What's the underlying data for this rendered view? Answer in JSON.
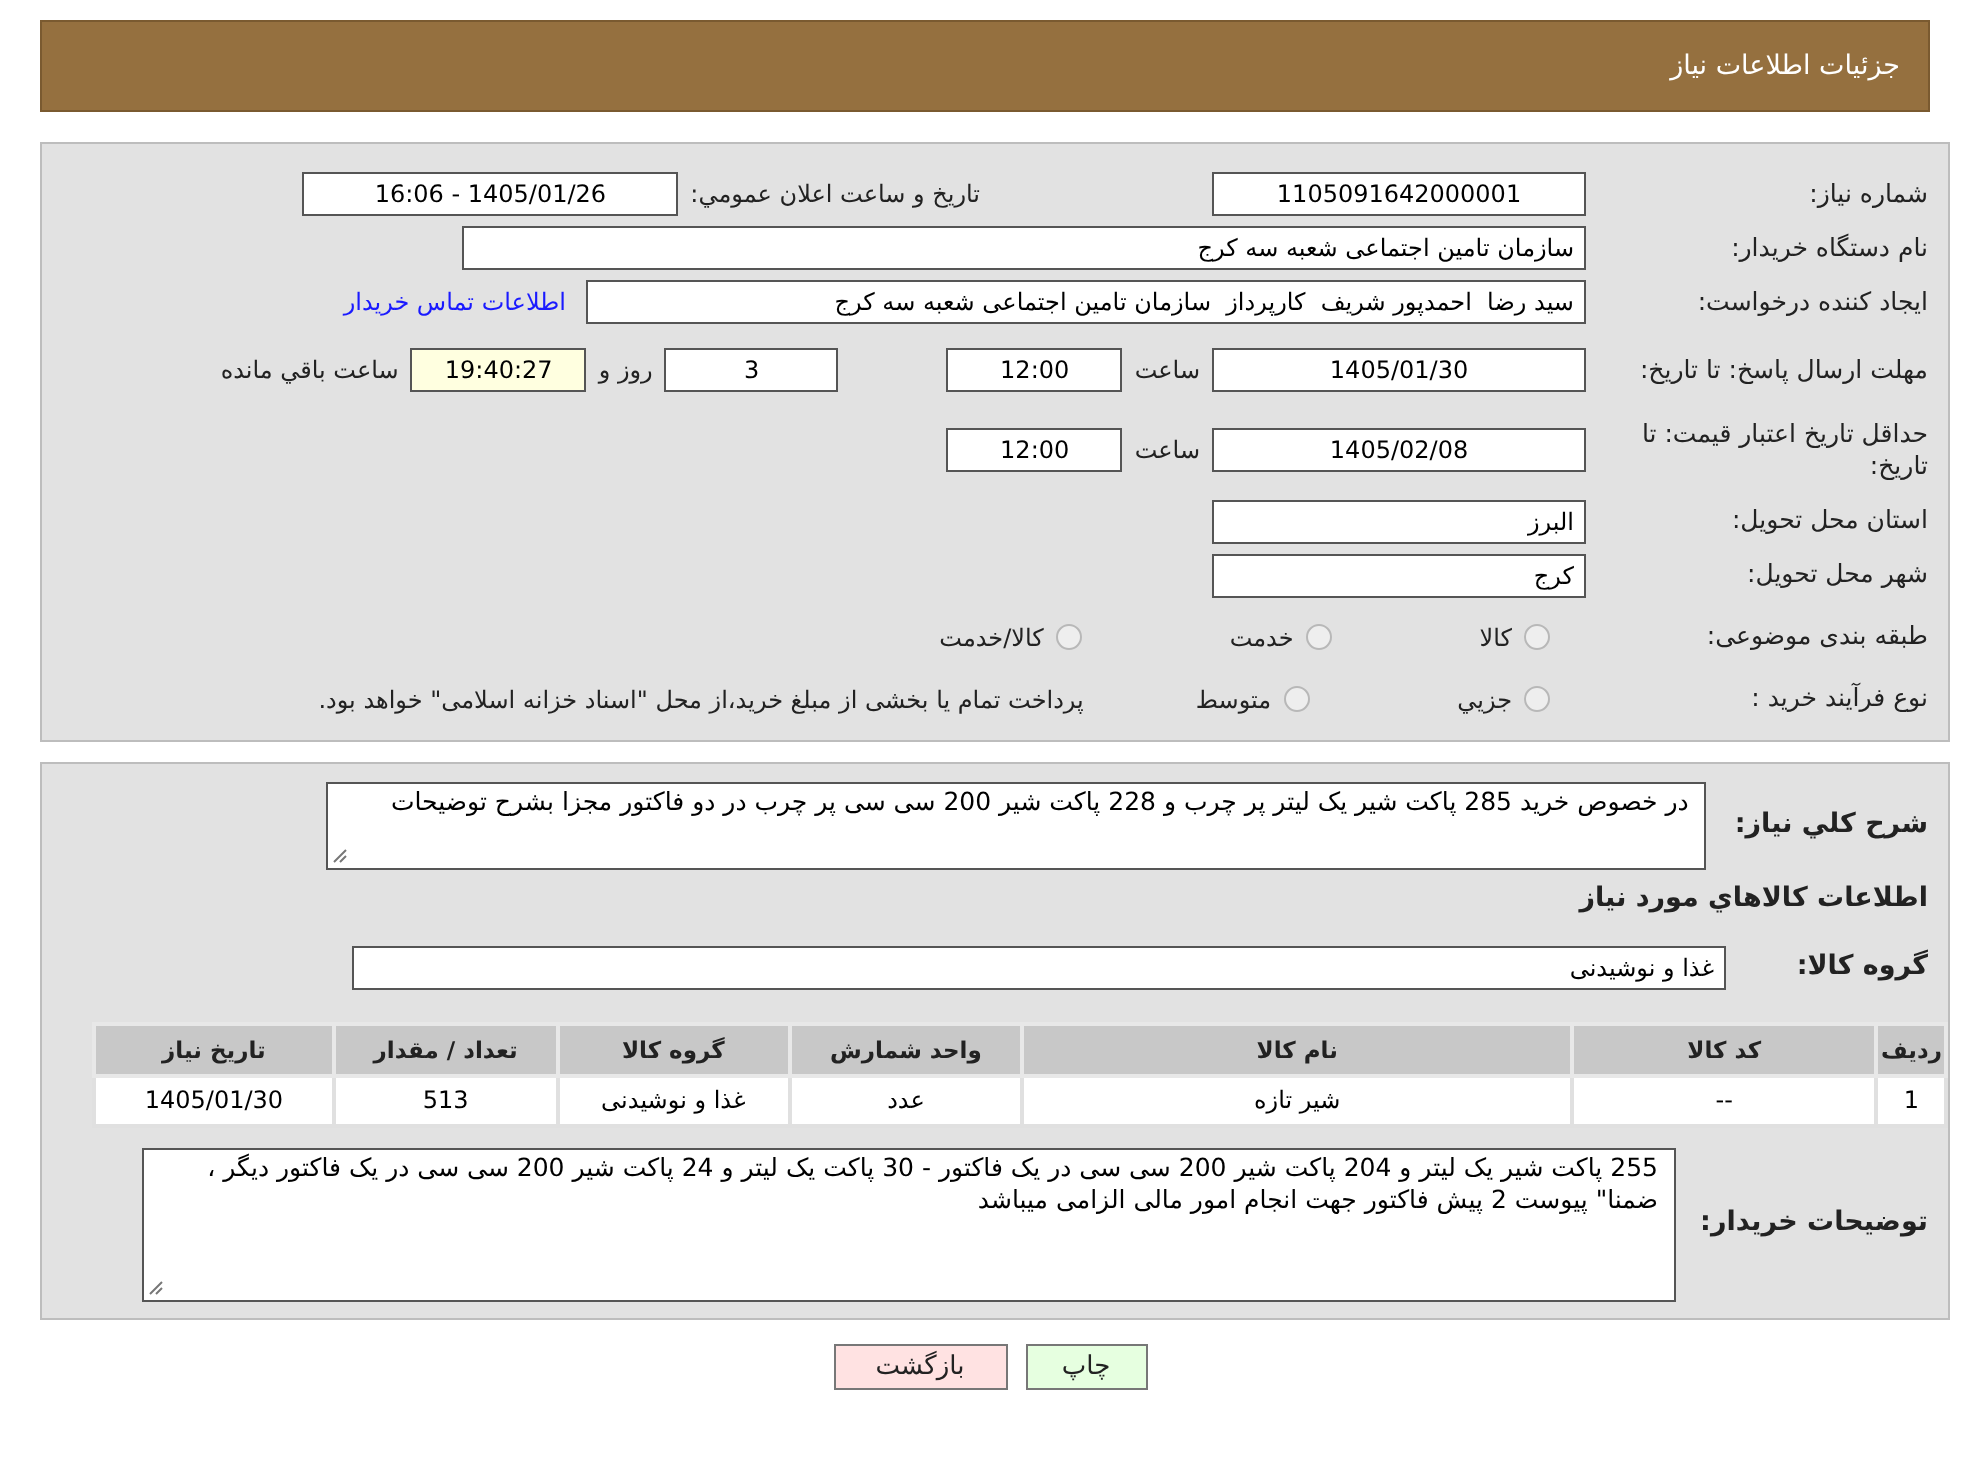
{
  "header": {
    "title": "جزئیات اطلاعات نیاز"
  },
  "need_number": {
    "label": "شماره نیاز:",
    "value": "1105091642000001"
  },
  "announce": {
    "label": "تاریخ و ساعت اعلان عمومي:",
    "value": "1405/01/26 - 16:06"
  },
  "buyer_org": {
    "label": "نام دستگاه خریدار:",
    "value": "سازمان تامین اجتماعی شعبه سه کرج"
  },
  "requester": {
    "label": "ایجاد کننده درخواست:",
    "value": "سید رضا  احمدپور شریف  کارپرداز  سازمان تامین اجتماعی شعبه سه کرج",
    "link": "اطلاعات تماس خریدار"
  },
  "reply_deadline": {
    "label": "مهلت ارسال پاسخ: تا تاریخ:",
    "date": "1405/01/30",
    "time_label": "ساعت",
    "time": "12:00",
    "days": "3",
    "days_label": "روز و",
    "remaining": "19:40:27",
    "remaining_label": "ساعت باقي مانده"
  },
  "price_validity": {
    "label": "حداقل تاریخ اعتبار قیمت: تا تاریخ:",
    "date": "1405/02/08",
    "time_label": "ساعت",
    "time": "12:00"
  },
  "province": {
    "label": "استان محل تحویل:",
    "value": "البرز"
  },
  "city": {
    "label": "شهر محل تحویل:",
    "value": "کرج"
  },
  "category": {
    "label": "طبقه بندی موضوعی:",
    "options": [
      {
        "label": "کالا",
        "selected": false
      },
      {
        "label": "خدمت",
        "selected": false
      },
      {
        "label": "کالا/خدمت",
        "selected": false
      }
    ]
  },
  "purchase_type": {
    "label": "نوع فرآیند خرید :",
    "options": [
      {
        "label": "جزيي",
        "selected": false
      },
      {
        "label": "متوسط",
        "selected": false
      }
    ],
    "note": "پرداخت تمام یا بخشی از مبلغ خرید،از محل \"اسناد خزانه اسلامی\" خواهد بود."
  },
  "summary": {
    "label": "شرح کلي نیاز:",
    "value": "در خصوص خرید 285 پاکت شیر یک لیتر پر چرب و 228 پاکت شیر 200 سی سی پر چرب در دو فاکتور مجزا بشرح توضیحات"
  },
  "goods_heading": "اطلاعات کالاهاي مورد نیاز",
  "goods_group": {
    "label": "گروه کالا:",
    "value": "غذا و نوشیدنی"
  },
  "table": {
    "columns": [
      "ردیف",
      "کد کالا",
      "نام کالا",
      "واحد شمارش",
      "گروه کالا",
      "تعداد / مقدار",
      "تاریخ نیاز"
    ],
    "rows": [
      [
        "1",
        "--",
        "شیر تازه",
        "عدد",
        "غذا و نوشیدنی",
        "513",
        "1405/01/30"
      ]
    ]
  },
  "buyer_notes": {
    "label": "توضیحات خریدار:",
    "value": "255 پاکت شیر یک لیتر و 204 پاکت شیر 200 سی سی در یک فاکتور - 30 پاکت یک لیتر و 24 پاکت شیر 200 سی سی در یک فاکتور دیگر ، ضمنا\" پیوست 2 پیش فاکتور جهت انجام امور مالی الزامی میباشد"
  },
  "buttons": [
    {
      "label": "چاپ",
      "kind": "print"
    },
    {
      "label": "بازگشت",
      "kind": "back"
    }
  ]
}
